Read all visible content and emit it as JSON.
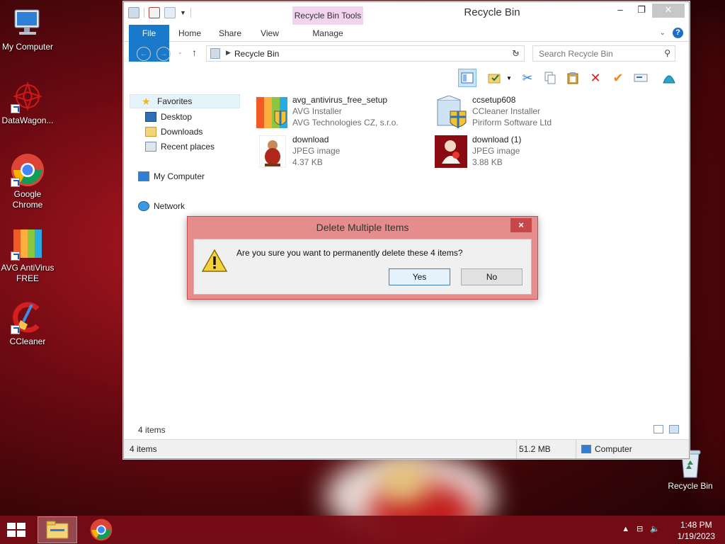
{
  "desktop": {
    "icons": [
      {
        "label": "My Computer"
      },
      {
        "label": "DataWagon..."
      },
      {
        "label": "Google Chrome"
      },
      {
        "label": "AVG AntiVirus FREE"
      },
      {
        "label": "CCleaner"
      },
      {
        "label": "Recycle Bin"
      }
    ]
  },
  "window": {
    "title": "Recycle Bin",
    "context_tab": "Recycle Bin Tools",
    "ribbon_tabs": [
      "File",
      "Home",
      "Share",
      "View",
      "Manage"
    ],
    "address": {
      "crumb": "Recycle Bin"
    },
    "search": {
      "placeholder": "Search Recycle Bin"
    }
  },
  "nav": {
    "favorites": "Favorites",
    "desktop": "Desktop",
    "downloads": "Downloads",
    "recent": "Recent places",
    "computer": "My Computer",
    "network": "Network"
  },
  "files": [
    {
      "name": "avg_antivirus_free_setup",
      "line2": "AVG Installer",
      "line3": "AVG Technologies CZ, s.r.o.",
      "icon": "avg-installer-icon"
    },
    {
      "name": "ccsetup608",
      "line2": "CCleaner Installer",
      "line3": "Piriform Software Ltd",
      "icon": "ccleaner-installer-icon"
    },
    {
      "name": "download",
      "line2": "JPEG image",
      "line3": "4.37 KB",
      "icon": "jpeg-thumbnail"
    },
    {
      "name": "download (1)",
      "line2": "JPEG image",
      "line3": "3.88 KB",
      "icon": "jpeg-thumbnail"
    }
  ],
  "status": {
    "items_count": "4 items",
    "bottom_items": "4 items",
    "size": "51.2 MB",
    "location": "Computer"
  },
  "dialog": {
    "title": "Delete Multiple Items",
    "message": "Are you sure you want to permanently delete these 4 items?",
    "yes": "Yes",
    "no": "No",
    "close": "×"
  },
  "taskbar": {
    "time": "1:48 PM",
    "date": "1/19/2023"
  },
  "colors": {
    "dialog_frame": "#e58d8d",
    "ribbon_file": "#1979ca",
    "context_tab": "#f2d4ee"
  }
}
